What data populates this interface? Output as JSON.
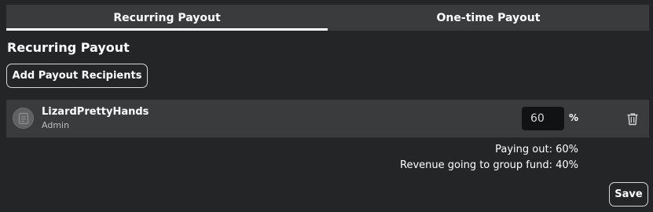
{
  "tabs": [
    {
      "label": "Recurring Payout",
      "active": true
    },
    {
      "label": "One-time Payout",
      "active": false
    }
  ],
  "section": {
    "title": "Recurring Payout",
    "add_button_label": "Add Payout Recipients"
  },
  "recipients": [
    {
      "name": "LizardPrettyHands",
      "role": "Admin",
      "percent_value": "60",
      "percent_sign": "%",
      "avatar_icon": "avatar-placeholder-icon",
      "remove_icon": "trash-icon"
    }
  ],
  "summary": {
    "paying_out": "Paying out: 60%",
    "group_fund": "Revenue going to group fund: 40%"
  },
  "footer": {
    "save_label": "Save"
  },
  "colors": {
    "background": "#232527",
    "panel": "#393b3d",
    "input_bg": "#111214",
    "text": "#ffffff",
    "muted_text": "#bdbebe",
    "border": "#d5d7d9"
  }
}
